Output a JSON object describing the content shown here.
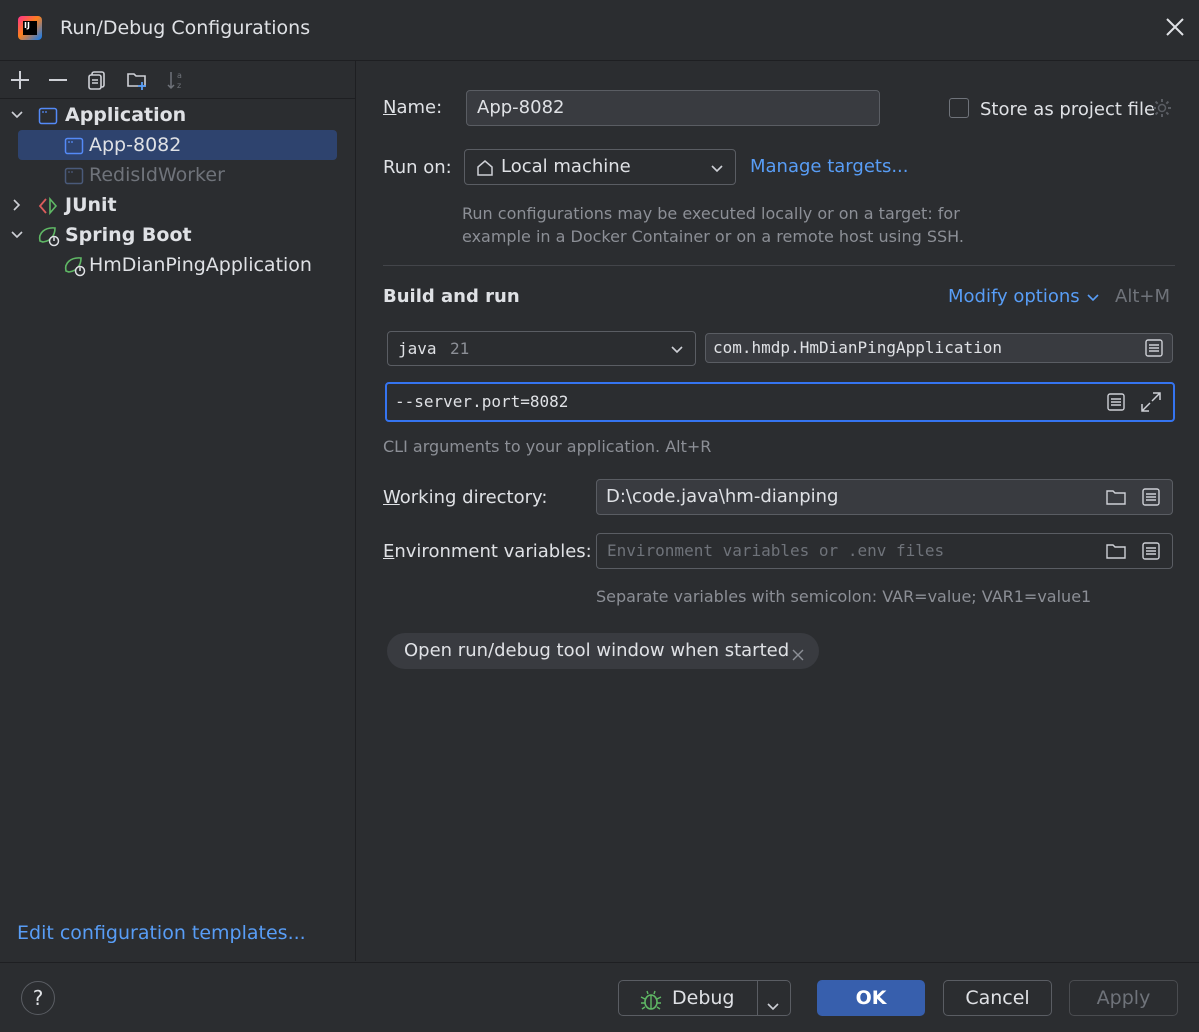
{
  "window": {
    "title": "Run/Debug Configurations",
    "logo_text": "IJ"
  },
  "sidebar": {
    "tree": [
      {
        "label": "Application",
        "expanded": true
      },
      {
        "label": "App-8082",
        "selected": true
      },
      {
        "label": "RedisIdWorker",
        "disabled": true
      },
      {
        "label": "JUnit",
        "expanded": false
      },
      {
        "label": "Spring Boot",
        "expanded": true
      },
      {
        "label": "HmDianPingApplication"
      }
    ],
    "edit_templates_link": "Edit configuration templates..."
  },
  "form": {
    "name_label_accel": "N",
    "name_label_rest": "ame:",
    "name_value": "App-8082",
    "store_as_project_file": "Store as project file",
    "store_checked": false,
    "run_on_label": "Run on:",
    "run_on_value": "Local machine",
    "manage_targets": "Manage targets...",
    "run_on_hint_1": "Run configurations may be executed locally or on a target: for",
    "run_on_hint_2": "example in a Docker Container or on a remote host using SSH.",
    "build_and_run": "Build and run",
    "modify_options": "Modify options",
    "modify_options_shortcut": "Alt+M",
    "jdk_name": "java",
    "jdk_version": "21",
    "main_class": "com.hmdp.HmDianPingApplication",
    "program_args": "--server.port=8082",
    "cli_hint": "CLI arguments to your application. Alt+R",
    "working_dir_accel": "W",
    "working_dir_rest": "orking directory:",
    "working_dir_value": "D:\\code.java\\hm-dianping",
    "env_accel": "E",
    "env_rest": "nvironment variables:",
    "env_placeholder": "Environment variables or .env files",
    "env_hint": "Separate variables with semicolon: VAR=value; VAR1=value1",
    "chip_label": "Open run/debug tool window when started"
  },
  "footer": {
    "help": "?",
    "debug": "Debug",
    "ok": "OK",
    "cancel": "Cancel",
    "apply": "Apply"
  },
  "colors": {
    "background": "#2b2d30",
    "accent_link": "#589df6",
    "selection": "#2e436e",
    "focus_border": "#3574f0",
    "ok_button": "#375fad"
  }
}
